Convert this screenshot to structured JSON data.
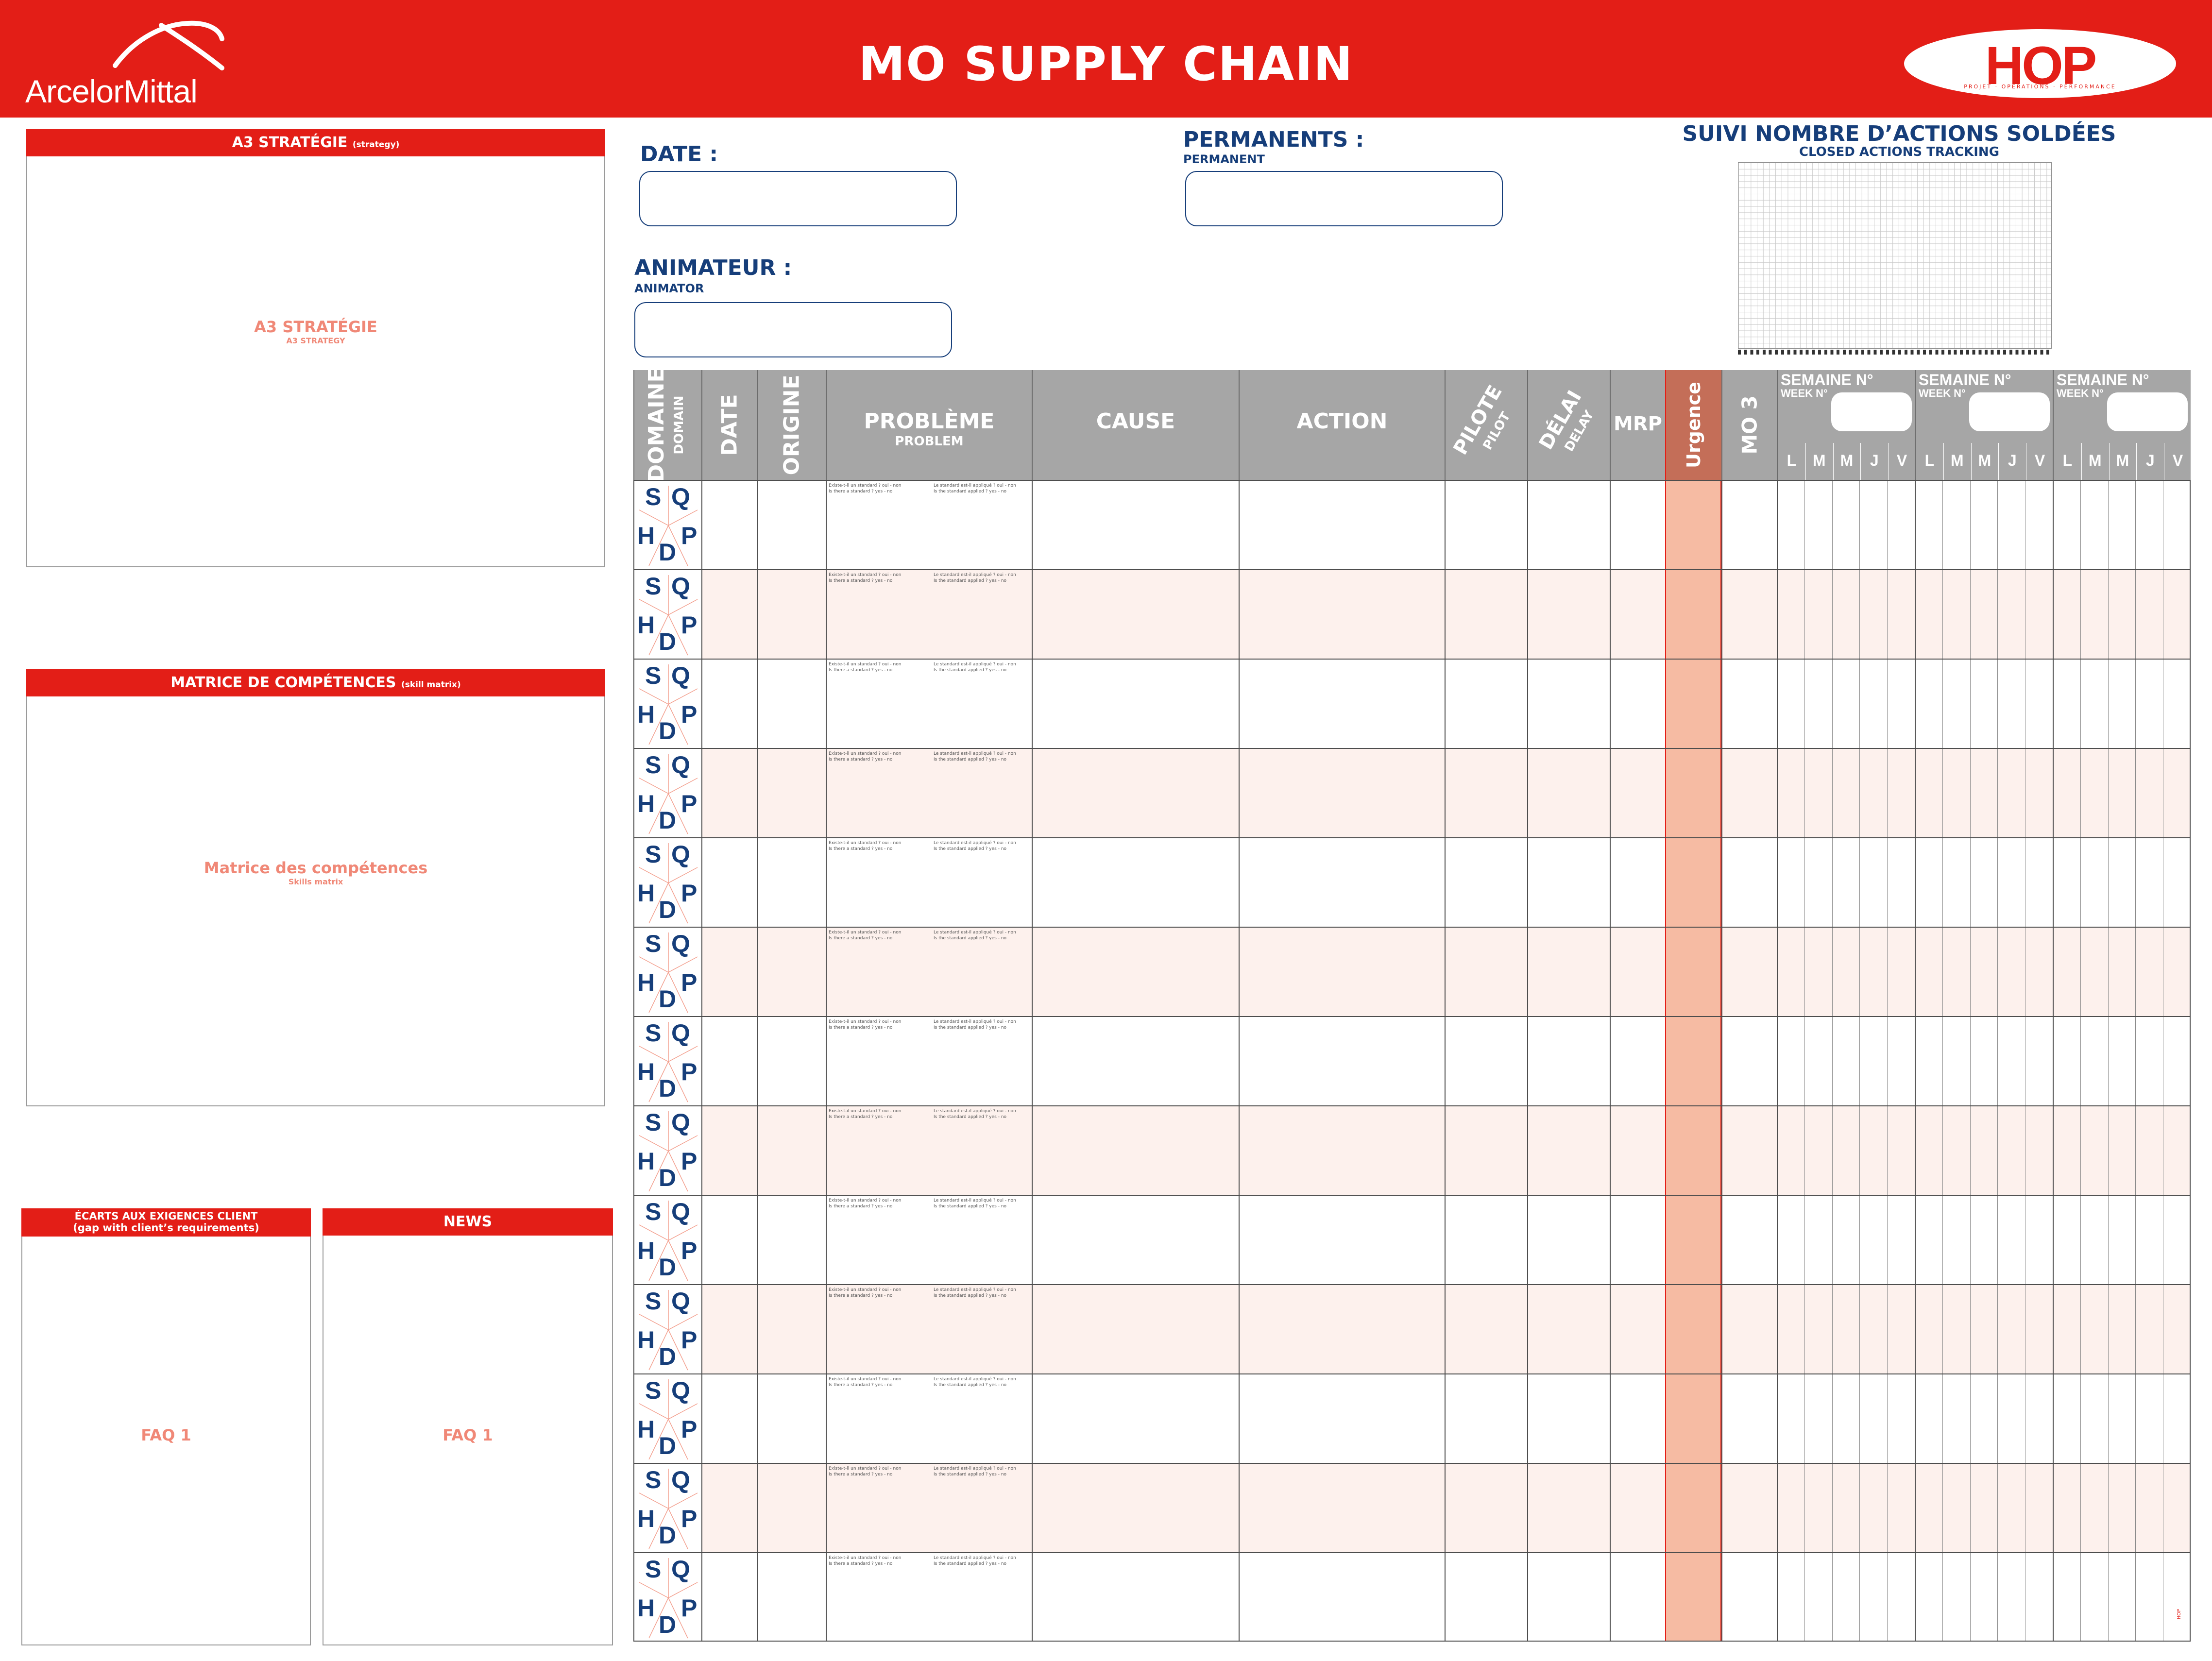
{
  "header": {
    "title": "MO SUPPLY CHAIN",
    "logo_left": "ArcelorMittal",
    "logo_right": "HOP",
    "logo_right_sub": "PROJET · OPERATIONS · PERFORMANCE"
  },
  "panels": {
    "a3": {
      "title": "A3 STRATÉGIE",
      "title_sub": "(strategy)",
      "body": "A3 STRATÉGIE",
      "body_sub": "A3 STRATEGY"
    },
    "skills": {
      "title": "MATRICE DE COMPÉTENCES",
      "title_sub": "(skill matrix)",
      "body": "Matrice des compétences",
      "body_sub": "Skills matrix"
    },
    "gaps": {
      "title_line1": "ÉCARTS AUX EXIGENCES CLIENT",
      "title_line2": "(gap with client’s requirements)",
      "body": "FAQ 1"
    },
    "news": {
      "title": "NEWS",
      "body": "FAQ 1"
    }
  },
  "fields": {
    "date": {
      "label": "DATE :",
      "sub": ""
    },
    "permanents": {
      "label": "PERMANENTS :",
      "sub": "PERMANENT"
    },
    "animateur": {
      "label": "ANIMATEUR :",
      "sub": "ANIMATOR"
    }
  },
  "tracking": {
    "title": "SUIVI NOMBRE D’ACTIONS SOLDÉES",
    "subtitle": "CLOSED ACTIONS TRACKING"
  },
  "table": {
    "headers": {
      "domaine": "DOMAINE",
      "domaine_sub": "DOMAIN",
      "date": "DATE",
      "origine": "ORIGINE",
      "probleme": "PROBLÈME",
      "probleme_sub": "PROBLEM",
      "cause": "CAUSE",
      "action": "ACTION",
      "pilote": "PILOTE",
      "pilote_sub": "PILOT",
      "delai": "DÉLAI",
      "delai_sub": "DELAY",
      "mrp": "MRP",
      "urgence": "Urgence",
      "mo3": "MO 3"
    },
    "week_label": "SEMAINE N°",
    "week_sub": "WEEK N°",
    "days": [
      "L",
      "M",
      "M",
      "J",
      "V"
    ],
    "domain_letters": [
      "S",
      "Q",
      "H",
      "D",
      "P"
    ],
    "problem_prompt_1": "Existe-t-il un standard ? oui - non",
    "problem_prompt_1_en": "Is there a standard ? yes - no",
    "problem_prompt_2": "Le standard est-il appliqué ? oui - non",
    "problem_prompt_2_en": "Is the standard applied ? yes - no",
    "row_count": 13
  },
  "colors": {
    "brand_red": "#e31e17",
    "brand_blue": "#163e7a",
    "header_gray": "#a6a6a6",
    "urgence_fill": "#f6bba3",
    "row_tint": "#fdf1ed",
    "label_pink": "#f08877"
  }
}
